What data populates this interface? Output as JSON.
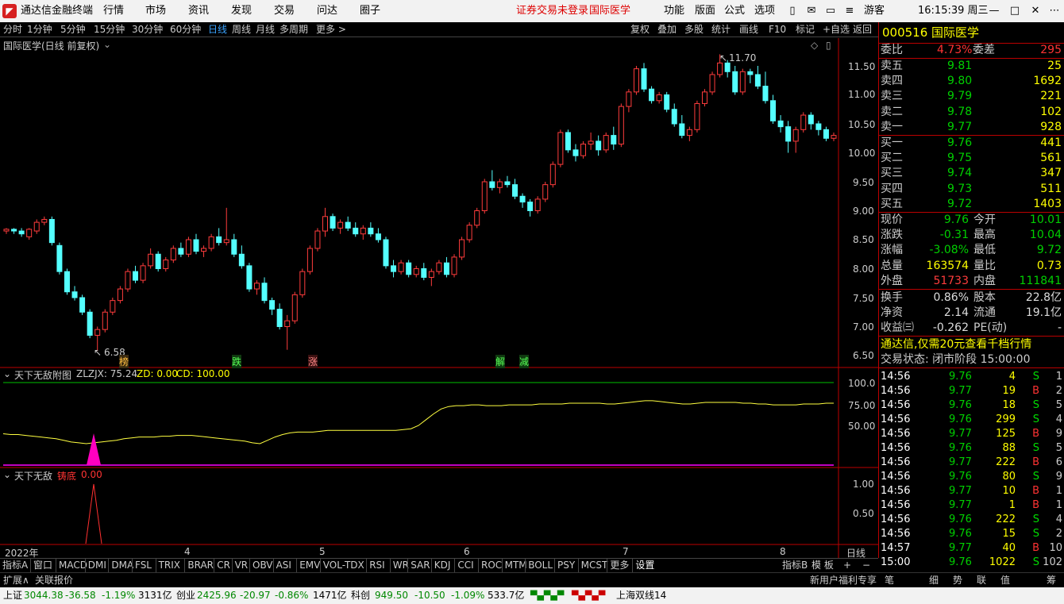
{
  "titlebar": {
    "app_name": "通达信金融终端",
    "menus": [
      "行情",
      "市场",
      "资讯",
      "发现",
      "交易",
      "问达",
      "圈子"
    ],
    "notice_login": "证券交易未登录",
    "notice_stock": "国际医学",
    "right_menus": [
      "功能",
      "版面",
      "公式",
      "选项"
    ],
    "user": "游客",
    "time": "16:15:39 周三"
  },
  "toolbar": {
    "periods": [
      "分时",
      "1分钟",
      "5分钟",
      "15分钟",
      "30分钟",
      "60分钟",
      "日线",
      "周线",
      "月线",
      "多周期",
      "更多 >"
    ],
    "active_period": "日线",
    "actions": [
      "复权",
      "叠加",
      "多股",
      "统计",
      "画线",
      "F10",
      "标记",
      "+自选",
      "返回"
    ]
  },
  "main_chart": {
    "label": "国际医学(日线 前复权)",
    "high_label": "11.70",
    "low_label": "6.58",
    "marks": [
      "榜",
      "跌",
      "涨",
      "解",
      "减"
    ],
    "y_ticks": [
      "11.50",
      "11.00",
      "10.50",
      "10.00",
      "9.50",
      "9.00",
      "8.50",
      "8.00",
      "7.50",
      "7.00",
      "6.50"
    ]
  },
  "indicator1": {
    "label_name": "天下无敌附图",
    "label_zlzjx": "ZLZJX: 75.24",
    "label_zd": "ZD: 0.00",
    "label_cd": "CD: 100.00",
    "y_ticks": [
      "100.0",
      "75.00",
      "50.00"
    ]
  },
  "indicator2": {
    "label_name": "天下无敌",
    "label_zhudi": "铸底",
    "label_value": "0.00",
    "y_ticks": [
      "1.00",
      "0.50"
    ]
  },
  "x_axis": {
    "labels": [
      "2022年",
      "4",
      "5",
      "6",
      "7",
      "8"
    ],
    "period_button": "日线"
  },
  "indicator_tabs": {
    "left_label": "指标A",
    "tabs": [
      "窗口",
      "MACD",
      "DMI",
      "DMA",
      "FSL",
      "TRIX",
      "BRAR",
      "CR",
      "VR",
      "OBV",
      "ASI",
      "EMV",
      "VOL-TDX",
      "RSI",
      "WR",
      "SAR",
      "KDJ",
      "CCI",
      "ROC",
      "MTM",
      "BOLL",
      "PSY",
      "MCST",
      "更多",
      "设置"
    ],
    "right_label": "指标B",
    "template_label": "模 板"
  },
  "subbar": {
    "expand": "扩展∧",
    "related": "关联报价",
    "promo": "新用户福利专享",
    "icons": [
      "笔",
      "细",
      "势",
      "联",
      "值",
      "筹"
    ]
  },
  "statusbar": {
    "sh_name": "上证",
    "sh_price": "3044.38",
    "sh_change": "-36.58",
    "sh_pct": "-1.19%",
    "sh_amount": "3131亿",
    "cy_name": "创业",
    "cy_price": "2425.96",
    "cy_change": "-20.97",
    "cy_pct": "-0.86%",
    "cy_amount": "1471亿",
    "kc_name": "科创",
    "kc_price": "949.50",
    "kc_change": "-10.50",
    "kc_pct": "-1.09%",
    "kc_amount": "533.7亿",
    "ticker": "上海双线14"
  },
  "quote": {
    "code": "000516",
    "name": "国际医学",
    "weibi_label": "委比",
    "weibi": "4.73%",
    "weicha_label": "委差",
    "weicha": "295",
    "asks": [
      {
        "label": "卖五",
        "price": "9.81",
        "vol": "25"
      },
      {
        "label": "卖四",
        "price": "9.80",
        "vol": "1692"
      },
      {
        "label": "卖三",
        "price": "9.79",
        "vol": "221"
      },
      {
        "label": "卖二",
        "price": "9.78",
        "vol": "102"
      },
      {
        "label": "卖一",
        "price": "9.77",
        "vol": "928"
      }
    ],
    "bids": [
      {
        "label": "买一",
        "price": "9.76",
        "vol": "441"
      },
      {
        "label": "买二",
        "price": "9.75",
        "vol": "561"
      },
      {
        "label": "买三",
        "price": "9.74",
        "vol": "347"
      },
      {
        "label": "买四",
        "price": "9.73",
        "vol": "511"
      },
      {
        "label": "买五",
        "price": "9.72",
        "vol": "1403"
      }
    ],
    "stats": [
      {
        "l1": "现价",
        "v1": "9.76",
        "l2": "今开",
        "v2": "10.01",
        "c1": "dn",
        "c2": "dn"
      },
      {
        "l1": "涨跌",
        "v1": "-0.31",
        "l2": "最高",
        "v2": "10.04",
        "c1": "dn",
        "c2": "dn"
      },
      {
        "l1": "涨幅",
        "v1": "-3.08%",
        "l2": "最低",
        "v2": "9.72",
        "c1": "dn",
        "c2": "dn"
      },
      {
        "l1": "总量",
        "v1": "163574",
        "l2": "量比",
        "v2": "0.73",
        "c1": "yel",
        "c2": "yel"
      },
      {
        "l1": "外盘",
        "v1": "51733",
        "l2": "内盘",
        "v2": "111841",
        "c1": "up",
        "c2": "dn"
      }
    ],
    "stats2": [
      {
        "l1": "换手",
        "v1": "0.86%",
        "l2": "股本",
        "v2": "22.8亿"
      },
      {
        "l1": "净资",
        "v1": "2.14",
        "l2": "流通",
        "v2": "19.1亿"
      },
      {
        "l1": "收益㈢",
        "v1": "-0.262",
        "l2": "PE(动)",
        "v2": "-"
      }
    ],
    "promo": "通达信,仅需20元查看千档行情",
    "trade_state": "交易状态: 闭市阶段 15:00:00",
    "ticks": [
      {
        "t": "14:56",
        "p": "9.76",
        "v": "4",
        "s": "S",
        "n": "1"
      },
      {
        "t": "14:56",
        "p": "9.77",
        "v": "19",
        "s": "B",
        "n": "2"
      },
      {
        "t": "14:56",
        "p": "9.76",
        "v": "18",
        "s": "S",
        "n": "5"
      },
      {
        "t": "14:56",
        "p": "9.76",
        "v": "299",
        "s": "S",
        "n": "4"
      },
      {
        "t": "14:56",
        "p": "9.77",
        "v": "125",
        "s": "B",
        "n": "9"
      },
      {
        "t": "14:56",
        "p": "9.76",
        "v": "88",
        "s": "S",
        "n": "5"
      },
      {
        "t": "14:56",
        "p": "9.77",
        "v": "222",
        "s": "B",
        "n": "6"
      },
      {
        "t": "14:56",
        "p": "9.76",
        "v": "80",
        "s": "S",
        "n": "9"
      },
      {
        "t": "14:56",
        "p": "9.77",
        "v": "10",
        "s": "B",
        "n": "1"
      },
      {
        "t": "14:56",
        "p": "9.77",
        "v": "1",
        "s": "B",
        "n": "1"
      },
      {
        "t": "14:56",
        "p": "9.76",
        "v": "222",
        "s": "S",
        "n": "4"
      },
      {
        "t": "14:56",
        "p": "9.76",
        "v": "15",
        "s": "S",
        "n": "2"
      },
      {
        "t": "14:57",
        "p": "9.77",
        "v": "40",
        "s": "B",
        "n": "10"
      },
      {
        "t": "15:00",
        "p": "9.76",
        "v": "1022",
        "s": "S",
        "n": "102"
      }
    ]
  },
  "chart_data": {
    "type": "candlestick",
    "x": [
      "2022-03",
      "2022-04",
      "2022-05",
      "2022-06",
      "2022-07",
      "2022-08"
    ],
    "ylim": [
      6.4,
      11.8
    ],
    "high": 11.7,
    "low": 6.58,
    "candles": [
      [
        8.65,
        8.7,
        8.6,
        8.68
      ],
      [
        8.68,
        8.7,
        8.6,
        8.65
      ],
      [
        8.65,
        8.7,
        8.55,
        8.6
      ],
      [
        8.55,
        8.7,
        8.5,
        8.68
      ],
      [
        8.65,
        8.85,
        8.6,
        8.8
      ],
      [
        8.8,
        8.9,
        8.75,
        8.85
      ],
      [
        8.85,
        8.9,
        8.4,
        8.45
      ],
      [
        8.4,
        8.45,
        7.9,
        7.95
      ],
      [
        7.95,
        8.0,
        7.55,
        7.6
      ],
      [
        7.6,
        7.7,
        7.45,
        7.5
      ],
      [
        7.5,
        7.55,
        7.2,
        7.25
      ],
      [
        7.25,
        7.3,
        6.8,
        6.85
      ],
      [
        6.85,
        7.0,
        6.58,
        6.95
      ],
      [
        6.95,
        7.3,
        6.9,
        7.25
      ],
      [
        7.25,
        7.5,
        7.2,
        7.45
      ],
      [
        7.45,
        7.7,
        7.4,
        7.65
      ],
      [
        7.65,
        8.0,
        7.6,
        7.95
      ],
      [
        7.95,
        8.05,
        7.75,
        7.8
      ],
      [
        7.8,
        8.1,
        7.75,
        8.05
      ],
      [
        8.05,
        8.35,
        8.0,
        8.25
      ],
      [
        8.25,
        8.3,
        7.95,
        8.0
      ],
      [
        8.0,
        8.2,
        7.95,
        8.15
      ],
      [
        8.15,
        8.4,
        8.1,
        8.35
      ],
      [
        8.35,
        8.45,
        8.2,
        8.25
      ],
      [
        8.25,
        8.55,
        8.2,
        8.5
      ],
      [
        8.5,
        8.6,
        8.25,
        8.3
      ],
      [
        8.3,
        8.4,
        8.2,
        8.35
      ],
      [
        8.35,
        8.6,
        8.3,
        8.55
      ],
      [
        8.55,
        8.7,
        8.4,
        8.45
      ],
      [
        8.45,
        9.05,
        8.4,
        8.5
      ],
      [
        8.5,
        8.6,
        8.2,
        8.25
      ],
      [
        8.25,
        8.4,
        8.0,
        8.05
      ],
      [
        8.05,
        8.1,
        7.6,
        7.65
      ],
      [
        7.65,
        7.8,
        7.55,
        7.75
      ],
      [
        7.75,
        7.85,
        7.4,
        7.45
      ],
      [
        7.45,
        7.5,
        7.2,
        7.3
      ],
      [
        7.3,
        7.4,
        6.95,
        7.0
      ],
      [
        7.0,
        7.2,
        6.6,
        7.1
      ],
      [
        7.1,
        7.6,
        7.05,
        7.55
      ],
      [
        7.55,
        8.0,
        7.5,
        7.95
      ],
      [
        7.95,
        8.4,
        7.9,
        8.35
      ],
      [
        8.35,
        8.7,
        8.3,
        8.65
      ],
      [
        8.65,
        9.05,
        8.55,
        8.9
      ],
      [
        8.9,
        8.95,
        8.65,
        8.7
      ],
      [
        8.7,
        8.85,
        8.6,
        8.8
      ],
      [
        8.8,
        8.9,
        8.65,
        8.7
      ],
      [
        8.7,
        8.8,
        8.55,
        8.6
      ],
      [
        8.6,
        8.75,
        8.5,
        8.7
      ],
      [
        8.7,
        8.8,
        8.55,
        8.6
      ],
      [
        8.6,
        8.7,
        8.45,
        8.5
      ],
      [
        8.5,
        8.55,
        8.0,
        8.05
      ],
      [
        8.05,
        8.15,
        7.85,
        7.95
      ],
      [
        7.95,
        8.15,
        7.9,
        8.1
      ],
      [
        8.1,
        8.15,
        7.85,
        7.9
      ],
      [
        7.9,
        8.05,
        7.85,
        8.0
      ],
      [
        8.0,
        8.1,
        7.8,
        7.85
      ],
      [
        7.85,
        8.0,
        7.7,
        7.95
      ],
      [
        7.95,
        8.15,
        7.9,
        8.1
      ],
      [
        8.1,
        8.2,
        7.85,
        7.9
      ],
      [
        7.9,
        8.25,
        7.85,
        8.2
      ],
      [
        8.2,
        8.55,
        8.15,
        8.5
      ],
      [
        8.5,
        8.8,
        8.45,
        8.75
      ],
      [
        8.75,
        9.05,
        8.7,
        9.0
      ],
      [
        9.0,
        9.55,
        8.95,
        9.5
      ],
      [
        9.5,
        9.7,
        9.35,
        9.4
      ],
      [
        9.4,
        9.55,
        9.3,
        9.5
      ],
      [
        9.5,
        9.6,
        9.4,
        9.45
      ],
      [
        9.45,
        9.55,
        9.2,
        9.25
      ],
      [
        9.25,
        9.3,
        9.05,
        9.15
      ],
      [
        9.15,
        9.2,
        8.9,
        9.0
      ],
      [
        9.0,
        9.25,
        8.95,
        9.2
      ],
      [
        9.2,
        9.5,
        9.15,
        9.45
      ],
      [
        9.45,
        9.85,
        9.4,
        9.8
      ],
      [
        9.8,
        10.4,
        9.75,
        10.35
      ],
      [
        10.35,
        10.4,
        10.0,
        10.05
      ],
      [
        10.05,
        10.15,
        9.85,
        9.95
      ],
      [
        9.95,
        10.2,
        9.9,
        10.15
      ],
      [
        10.15,
        10.35,
        10.05,
        10.2
      ],
      [
        10.2,
        10.3,
        9.95,
        10.05
      ],
      [
        10.05,
        10.35,
        10.0,
        10.3
      ],
      [
        10.3,
        10.45,
        10.05,
        10.15
      ],
      [
        10.15,
        10.85,
        10.1,
        10.8
      ],
      [
        10.8,
        11.1,
        10.7,
        11.05
      ],
      [
        11.05,
        11.5,
        11.0,
        11.45
      ],
      [
        11.45,
        11.55,
        11.05,
        11.1
      ],
      [
        11.1,
        11.15,
        10.85,
        10.9
      ],
      [
        10.9,
        11.05,
        10.85,
        11.0
      ],
      [
        11.0,
        11.05,
        10.7,
        10.75
      ],
      [
        10.75,
        10.85,
        10.45,
        10.5
      ],
      [
        10.5,
        10.65,
        10.25,
        10.3
      ],
      [
        10.3,
        10.45,
        10.2,
        10.4
      ],
      [
        10.4,
        10.9,
        10.35,
        10.85
      ],
      [
        10.85,
        11.1,
        10.8,
        11.05
      ],
      [
        11.05,
        11.4,
        11.0,
        11.35
      ],
      [
        11.35,
        11.7,
        11.3,
        11.55
      ],
      [
        11.55,
        11.6,
        11.3,
        11.4
      ],
      [
        11.4,
        11.5,
        11.0,
        11.05
      ],
      [
        11.05,
        11.45,
        11.0,
        11.4
      ],
      [
        11.4,
        11.45,
        11.2,
        11.35
      ],
      [
        11.35,
        11.5,
        11.1,
        11.15
      ],
      [
        11.15,
        11.4,
        10.85,
        10.9
      ],
      [
        10.9,
        11.0,
        10.5,
        10.55
      ],
      [
        10.55,
        10.65,
        10.35,
        10.45
      ],
      [
        10.45,
        10.55,
        10.0,
        10.2
      ],
      [
        10.2,
        10.45,
        10.0,
        10.4
      ],
      [
        10.4,
        10.7,
        10.35,
        10.65
      ],
      [
        10.65,
        10.7,
        10.4,
        10.5
      ],
      [
        10.5,
        10.55,
        10.3,
        10.4
      ],
      [
        10.4,
        10.45,
        10.2,
        10.25
      ],
      [
        10.25,
        10.35,
        10.2,
        10.3
      ]
    ],
    "indicator1_zlzjx": [
      38,
      37,
      37,
      36,
      35,
      34,
      33,
      32,
      30,
      28,
      27,
      26,
      27,
      28,
      29,
      30,
      32,
      33,
      34,
      34,
      34,
      35,
      35,
      36,
      36,
      36,
      35,
      34,
      33,
      32,
      31,
      30,
      29,
      27,
      26,
      30,
      34,
      37,
      39,
      40,
      40,
      40,
      41,
      42,
      42,
      42,
      42,
      42,
      42,
      42,
      42,
      42,
      42,
      43,
      44,
      48,
      55,
      62,
      68,
      71,
      72,
      72,
      73,
      73,
      72,
      72,
      72,
      73,
      73,
      73,
      73,
      74,
      74,
      74,
      74,
      75,
      75,
      75,
      75,
      75,
      74,
      74,
      75,
      76,
      77,
      78,
      78,
      77,
      76,
      75,
      74,
      74,
      75,
      76,
      76,
      76,
      76,
      76,
      75,
      75,
      74,
      74,
      73,
      73,
      73,
      73,
      74,
      74,
      74,
      75,
      75
    ],
    "indicator1_signal_index": 20,
    "indicator2_signal_index": 20
  }
}
